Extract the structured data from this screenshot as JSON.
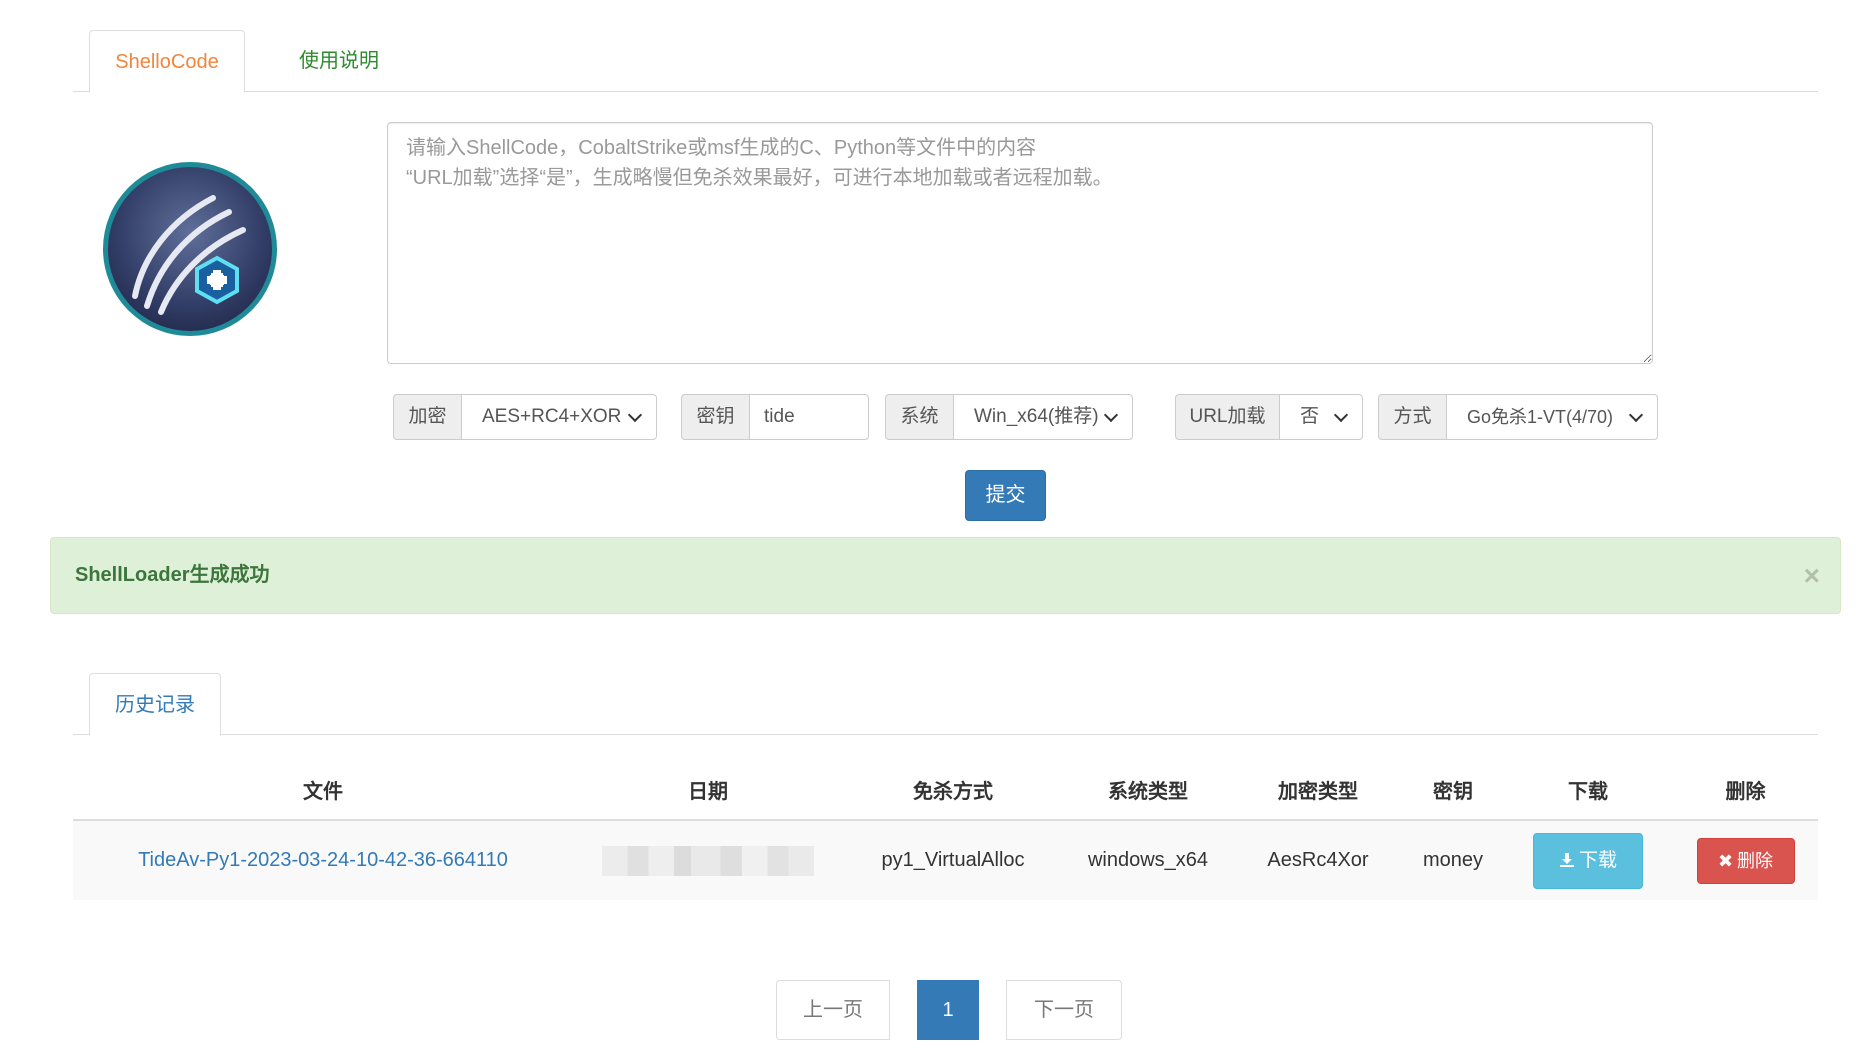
{
  "tabs_top": {
    "shellcode": "ShelloCode",
    "usage": "使用说明"
  },
  "shellcode_input": {
    "placeholder": "请输入ShellCode，CobaltStrike或msf生成的C、Python等文件中的内容\n“URL加载”选择“是”，生成略慢但免杀效果最好，可进行本地加载或者远程加载。"
  },
  "options": {
    "encrypt": {
      "label": "加密",
      "value": "AES+RC4+XOR"
    },
    "key": {
      "label": "密钥",
      "value": "tide"
    },
    "system": {
      "label": "系统",
      "value": "Win_x64(推荐)"
    },
    "url_load": {
      "label": "URL加载",
      "value": "否"
    },
    "method": {
      "label": "方式",
      "value": "Go免杀1-VT(4/70)"
    }
  },
  "submit_label": "提交",
  "alert": {
    "text": "ShellLoader生成成功",
    "close": "×"
  },
  "history_tab": "历史记录",
  "table": {
    "headers": [
      "文件",
      "日期",
      "免杀方式",
      "系统类型",
      "加密类型",
      "密钥",
      "下载",
      "删除"
    ],
    "rows": [
      {
        "file": "TideAv-Py1-2023-03-24-10-42-36-664110",
        "method": "py1_VirtualAlloc",
        "system": "windows_x64",
        "encrypt": "AesRc4Xor",
        "key": "money",
        "download": "下载",
        "delete": "删除"
      }
    ]
  },
  "pagination": {
    "prev": "上一页",
    "current": "1",
    "next": "下一页"
  },
  "colors": {
    "primary": "#337ab7",
    "success_bg": "#dff0d8",
    "success_text": "#3c763d",
    "info": "#5bc0de",
    "danger": "#d9534f",
    "active_tab": "#f0863c",
    "usage_tab": "#2e8b2e"
  }
}
